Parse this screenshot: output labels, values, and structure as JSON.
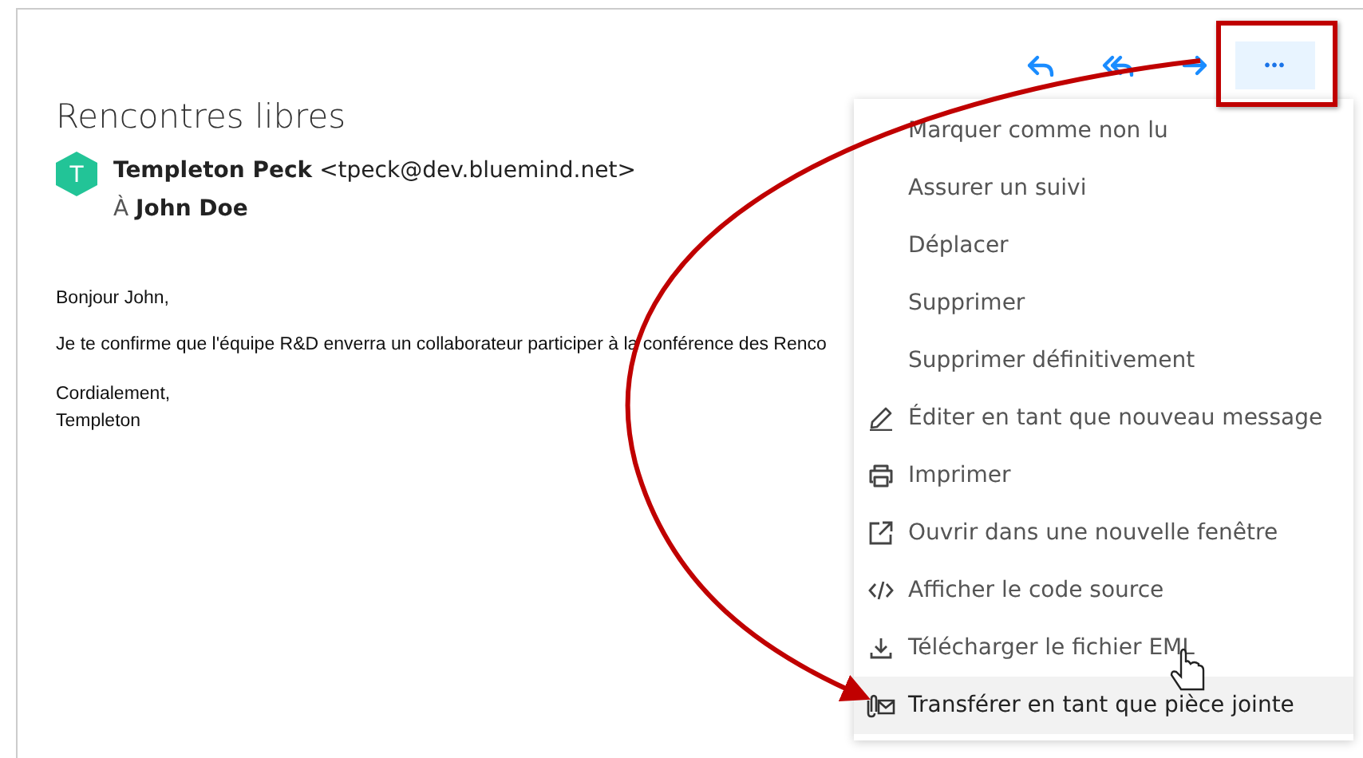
{
  "toolbar": {
    "more_button": "•••",
    "more_open": true
  },
  "message": {
    "subject": "Rencontres libres",
    "avatar_letter": "T",
    "sender_name": "Templeton Peck",
    "sender_email": "<tpeck@dev.bluemind.net>",
    "to_label": "À",
    "recipient": "John Doe",
    "body": [
      "Bonjour John,",
      "Je te confirme que l'équipe R&D enverra un collaborateur participer à la conférence des Renco"
    ],
    "signature": [
      "Cordialement,",
      "Templeton"
    ]
  },
  "menu": [
    {
      "label": "Marquer comme non lu",
      "kind": "text",
      "selected": false
    },
    {
      "label": "Assurer un suivi",
      "kind": "text",
      "selected": false
    },
    {
      "label": "Déplacer",
      "kind": "text",
      "selected": false
    },
    {
      "label": "Supprimer",
      "kind": "text",
      "selected": false
    },
    {
      "label": "Supprimer définitivement",
      "kind": "text",
      "selected": false
    },
    {
      "label": "Éditer en tant que nouveau message",
      "kind": "edit",
      "selected": false
    },
    {
      "label": "Imprimer",
      "kind": "print",
      "selected": false
    },
    {
      "label": "Ouvrir dans une nouvelle fenêtre",
      "kind": "open-window",
      "selected": false
    },
    {
      "label": "Afficher le code source",
      "kind": "code",
      "selected": false
    },
    {
      "label": "Télécharger le fichier EML",
      "kind": "download",
      "selected": false
    },
    {
      "label": "Transférer en tant que pièce jointe",
      "kind": "attach",
      "selected": true
    }
  ]
}
